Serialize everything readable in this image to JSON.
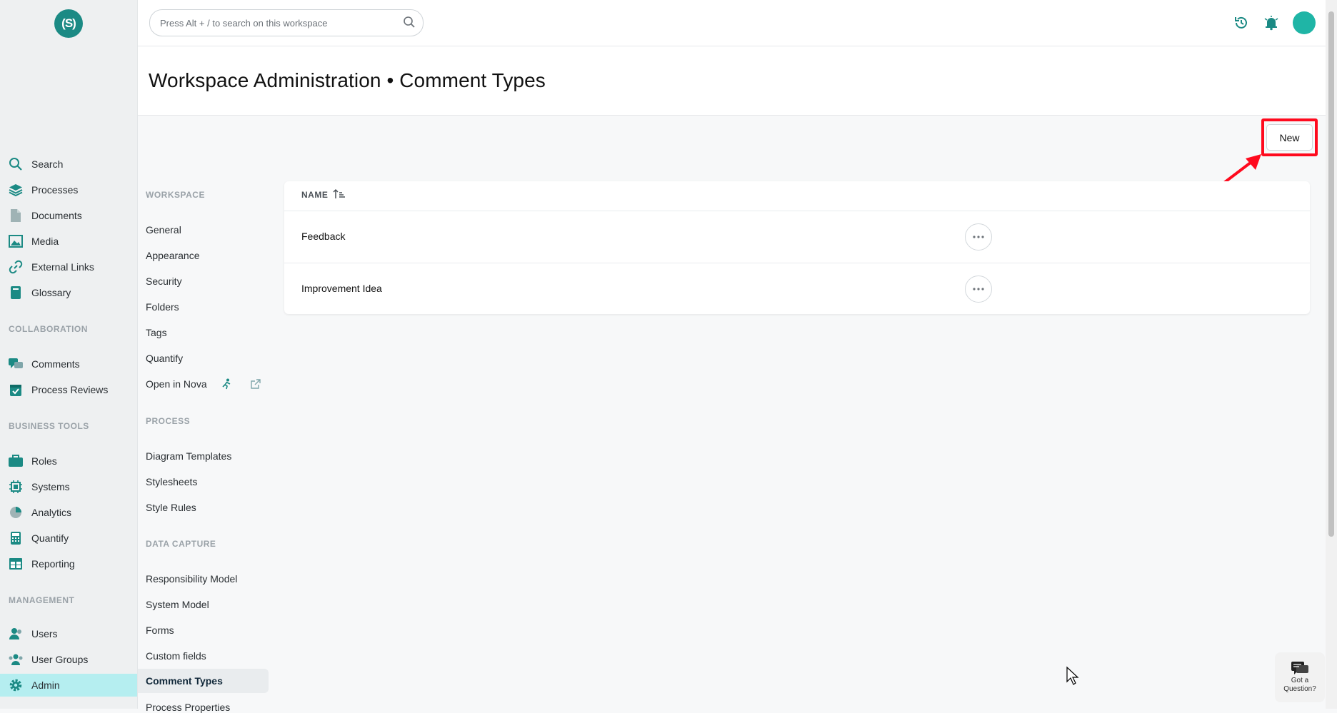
{
  "app": {
    "logo_text": "(S)",
    "brand_color": "#1b8a84",
    "accent_color": "#1fb5a6"
  },
  "search": {
    "placeholder": "Press Alt + / to search on this workspace"
  },
  "header": {
    "icons": [
      "history-icon",
      "notifications-icon",
      "user-avatar"
    ]
  },
  "page": {
    "title": "Workspace Administration • Comment Types"
  },
  "nav": {
    "main": [
      {
        "label": "Search",
        "icon": "search-icon"
      },
      {
        "label": "Processes",
        "icon": "layers-icon"
      },
      {
        "label": "Documents",
        "icon": "document-icon"
      },
      {
        "label": "Media",
        "icon": "image-icon"
      },
      {
        "label": "External Links",
        "icon": "link-icon"
      },
      {
        "label": "Glossary",
        "icon": "book-icon"
      }
    ],
    "collaboration_header": "COLLABORATION",
    "collaboration": [
      {
        "label": "Comments",
        "icon": "comments-icon"
      },
      {
        "label": "Process Reviews",
        "icon": "calendar-check-icon"
      }
    ],
    "business_header": "BUSINESS TOOLS",
    "business": [
      {
        "label": "Roles",
        "icon": "briefcase-icon"
      },
      {
        "label": "Systems",
        "icon": "chip-icon"
      },
      {
        "label": "Analytics",
        "icon": "pie-chart-icon"
      },
      {
        "label": "Quantify",
        "icon": "calculator-icon"
      },
      {
        "label": "Reporting",
        "icon": "table-icon"
      }
    ],
    "management_header": "MANAGEMENT",
    "management": [
      {
        "label": "Users",
        "icon": "user-icon"
      },
      {
        "label": "User Groups",
        "icon": "users-icon"
      },
      {
        "label": "Admin",
        "icon": "gear-icon",
        "active": true
      }
    ]
  },
  "admin_menu": {
    "workspace_header": "WORKSPACE",
    "workspace": [
      "General",
      "Appearance",
      "Security",
      "Folders",
      "Tags",
      "Quantify",
      "Open in Nova"
    ],
    "process_header": "PROCESS",
    "process": [
      "Diagram Templates",
      "Stylesheets",
      "Style Rules"
    ],
    "data_capture_header": "DATA CAPTURE",
    "data_capture": [
      "Responsibility Model",
      "System Model",
      "Forms",
      "Custom fields",
      "Comment Types",
      "Process Properties"
    ],
    "active": "Comment Types"
  },
  "toolbar": {
    "new_label": "New",
    "highlight_color": "#ff0a1e"
  },
  "table": {
    "columns": [
      "NAME"
    ],
    "sort": "ascending",
    "rows": [
      {
        "name": "Feedback"
      },
      {
        "name": "Improvement Idea"
      }
    ]
  },
  "help": {
    "label_line1": "Got a",
    "label_line2": "Question?"
  }
}
